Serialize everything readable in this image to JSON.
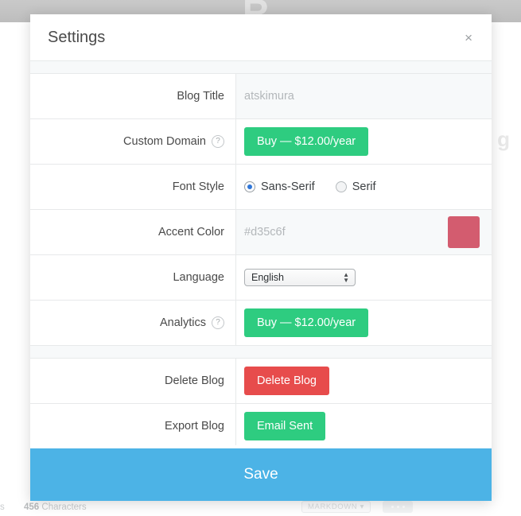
{
  "background": {
    "watermark": "R",
    "side_mark": "g",
    "footer": {
      "left_fragment": "s",
      "char_count_number": "456",
      "char_count_label": "Characters",
      "markdown_label": "MARKDOWN",
      "markdown_caret": "▾",
      "overflow_dots": "•••"
    }
  },
  "modal": {
    "title": "Settings",
    "close_label": "×",
    "rows": [
      {
        "label": "Blog Title",
        "has_help": false,
        "type": "input",
        "value": "atskimura"
      },
      {
        "label": "Custom Domain",
        "has_help": true,
        "help_glyph": "?",
        "type": "button",
        "button_label": "Buy — $12.00/year",
        "button_style": "green"
      },
      {
        "label": "Font Style",
        "has_help": false,
        "type": "radio",
        "options": [
          {
            "label": "Sans-Serif",
            "selected": true
          },
          {
            "label": "Serif",
            "selected": false
          }
        ]
      },
      {
        "label": "Accent Color",
        "has_help": false,
        "type": "color",
        "value": "#d35c6f",
        "swatch_color": "#d35c6f"
      },
      {
        "label": "Language",
        "has_help": false,
        "type": "select",
        "selected": "English",
        "options": [
          "English"
        ],
        "arrows": "⌃⌄"
      },
      {
        "label": "Analytics",
        "has_help": true,
        "help_glyph": "?",
        "type": "button",
        "button_label": "Buy — $12.00/year",
        "button_style": "green"
      },
      {
        "label": "Delete Blog",
        "has_help": false,
        "type": "button",
        "button_label": "Delete Blog",
        "button_style": "red"
      },
      {
        "label": "Export Blog",
        "has_help": false,
        "type": "button",
        "button_label": "Email Sent",
        "button_style": "green"
      }
    ],
    "save_label": "Save"
  },
  "colors": {
    "accent": "#d35c6f",
    "green": "#2ecc80",
    "red": "#e74c4c",
    "save_blue": "#4cb3e6"
  }
}
